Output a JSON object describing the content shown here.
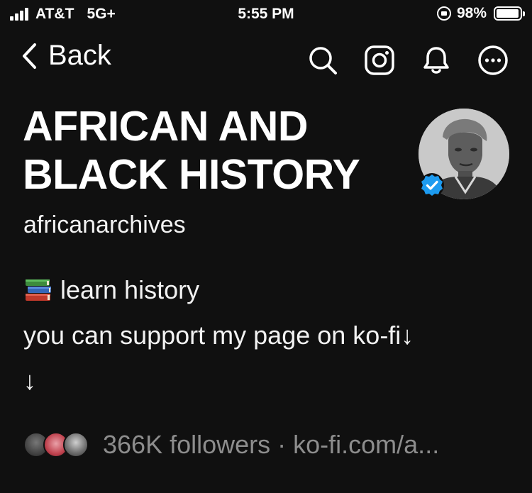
{
  "status_bar": {
    "carrier": "AT&T",
    "network": "5G+",
    "time": "5:55 PM",
    "battery": "98%",
    "battery_level": 0.98
  },
  "nav": {
    "back_label": "Back",
    "icons": [
      "search-icon",
      "instagram-icon",
      "bell-icon",
      "more-icon"
    ]
  },
  "profile": {
    "name": "AFRICAN AND\nBLACK HISTORY",
    "username": "africanarchives",
    "verified": true,
    "bio": {
      "line1": "learn history",
      "line1_icon": "books-emoji",
      "line2": "you can support my page on ko-fi↓",
      "line3": "↓"
    },
    "followers_text": "366K followers",
    "separator": "·",
    "link_text": "ko-fi.com/a..."
  },
  "colors": {
    "background": "#101010",
    "text": "#f5f5f5",
    "muted": "#8d8d8d",
    "verified_blue": "#1d9bf0"
  }
}
